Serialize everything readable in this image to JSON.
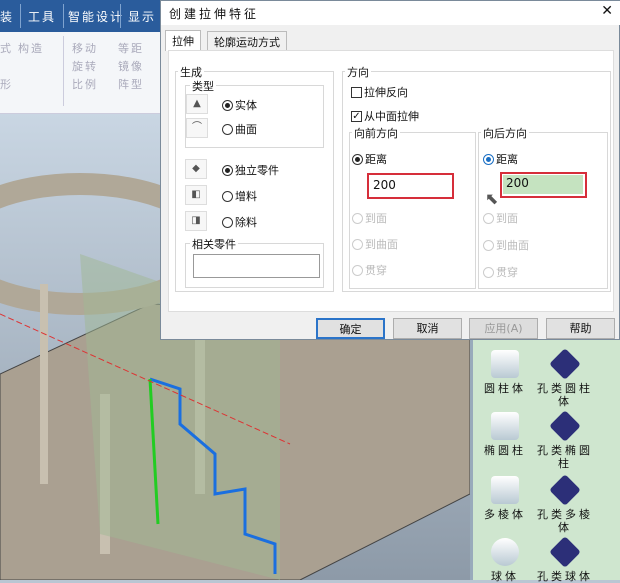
{
  "ribbon": {
    "tabs": [
      "装",
      "工具",
      "智能设计",
      "显示"
    ],
    "items": [
      "式",
      "构造",
      "移动",
      "等距",
      "旋转",
      "镜像",
      "比例",
      "阵型",
      "形"
    ]
  },
  "dialog": {
    "title": "创建拉伸特征",
    "close": "✕",
    "tabs": [
      "拉伸",
      "轮廓运动方式"
    ],
    "generate": {
      "label": "生成",
      "type_label": "类型",
      "type_options": [
        "实体",
        "曲面"
      ],
      "type_selected": "实体",
      "mode_options": [
        "独立零件",
        "增料",
        "除料"
      ],
      "mode_selected": "独立零件",
      "related_label": "相关零件",
      "related_value": ""
    },
    "direction": {
      "label": "方向",
      "reverse_label": "拉伸反向",
      "reverse_checked": false,
      "mid_label": "从中面拉伸",
      "mid_checked": true,
      "forward": {
        "label": "向前方向",
        "options": [
          "距离",
          "到面",
          "到曲面",
          "贯穿"
        ],
        "selected": "距离",
        "value": "200"
      },
      "backward": {
        "label": "向后方向",
        "options": [
          "距离",
          "到面",
          "到曲面",
          "贯穿"
        ],
        "selected": "距离",
        "value": "200"
      }
    },
    "buttons": {
      "ok": "确定",
      "cancel": "取消",
      "apply": "应用(A)",
      "help": "帮助"
    }
  },
  "library": {
    "items": [
      "圆柱体",
      "孔类圆柱体",
      "椭圆柱",
      "孔类椭圆柱",
      "多棱体",
      "孔类多棱体",
      "球体",
      "孔类球体"
    ]
  }
}
